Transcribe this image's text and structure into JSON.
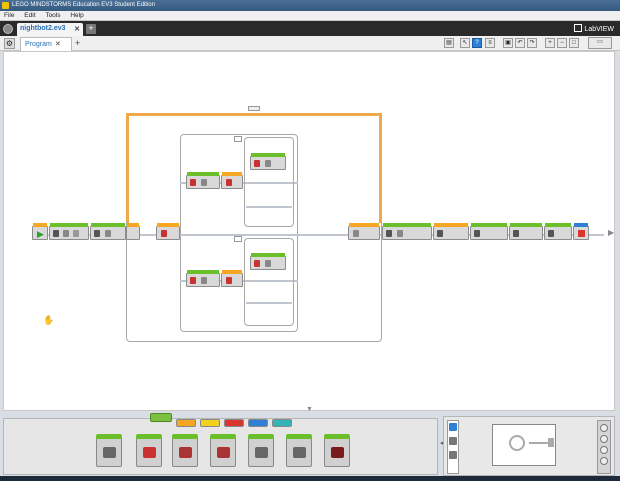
{
  "window": {
    "title": "LEGO MINDSTORMS Education EV3 Student Edition"
  },
  "menu": {
    "items": [
      "File",
      "Edit",
      "Tools",
      "Help"
    ]
  },
  "project_tab": {
    "label": "nightbot2.ev3",
    "close": "✕",
    "add": "+"
  },
  "brand": {
    "label": "LabVIEW"
  },
  "program_tab": {
    "label": "Program",
    "close": "✕",
    "add": "+"
  },
  "icons": {
    "home": "home-icon",
    "wrench": "wrench-icon",
    "labview": "labview-logo-icon",
    "select": "pointer-icon",
    "help": "help-icon",
    "comment": "comment-icon",
    "save": "save-icon",
    "undo": "undo-icon",
    "redo": "redo-icon",
    "zoom_in": "zoom-in-icon",
    "zoom_out": "zoom-out-icon",
    "zoom_fit": "zoom-fit-icon"
  },
  "palette": {
    "tab_colors": [
      "#7bc043",
      "#f5a623",
      "#f2d21f",
      "#d8362e",
      "#2f7fd6",
      "#33b5b5"
    ],
    "active_tab": 0,
    "block_names": [
      "medium-motor-block",
      "large-motor-block",
      "move-steering-block",
      "move-tank-block",
      "display-block",
      "sound-block",
      "brick-status-light-block"
    ]
  },
  "colors": {
    "action_green": "#6bbf2a",
    "flow_orange": "#f0a94a",
    "sensor_yellow": "#f2d21f",
    "end_red": "#d8362e",
    "selected_blue": "#2f7fd6"
  }
}
